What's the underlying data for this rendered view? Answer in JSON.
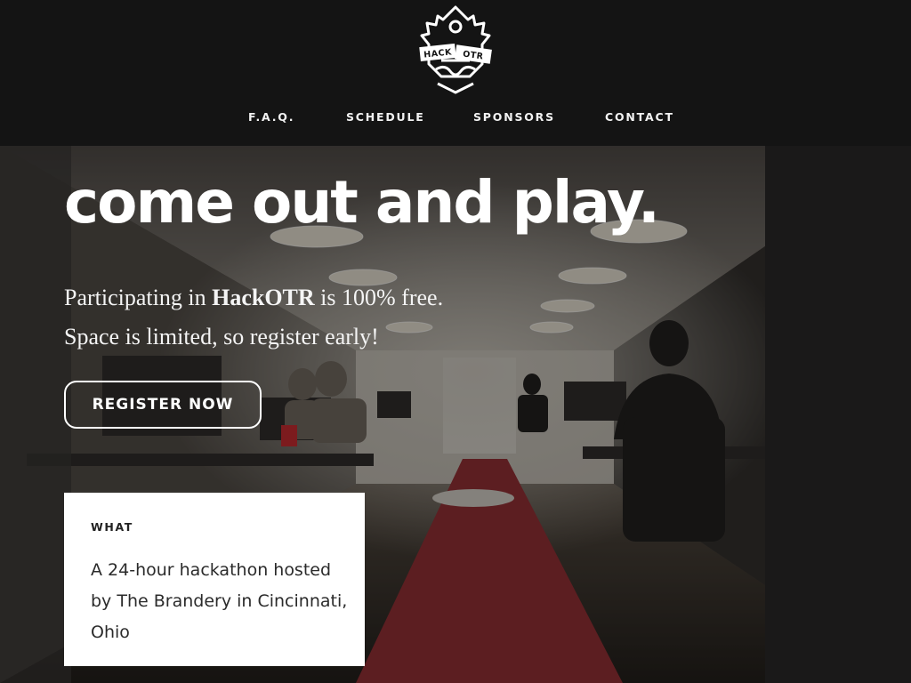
{
  "logo": {
    "left_word": "HACK",
    "right_word": "OTR",
    "icon": "hackotr-crest-icon"
  },
  "nav": {
    "items": [
      {
        "label": "F.A.Q."
      },
      {
        "label": "SCHEDULE"
      },
      {
        "label": "SPONSORS"
      },
      {
        "label": "CONTACT"
      }
    ]
  },
  "hero": {
    "headline": "come out and play.",
    "line1_prefix": "Participating in ",
    "line1_brand": "HackOTR",
    "line1_suffix": " is 100% free.",
    "line2": "Space is limited, so register early!",
    "register_label": "REGISTER NOW"
  },
  "what_card": {
    "label": "WHAT",
    "text": "A 24-hour hackathon hosted by The Brandery in Cincinnati, Ohio"
  },
  "colors": {
    "header_bg": "#141414",
    "carpet": "#8e2a30",
    "card_bg": "#ffffff",
    "text_light": "#ffffff"
  }
}
